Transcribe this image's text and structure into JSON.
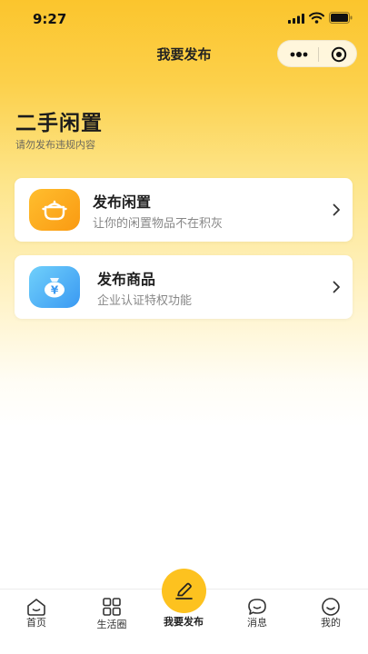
{
  "status_bar": {
    "time": "9:27"
  },
  "nav": {
    "title": "我要发布"
  },
  "header": {
    "title": "二手闲置",
    "subtitle": "请勿发布违规内容"
  },
  "cards": [
    {
      "title": "发布闲置",
      "description": "让你的闲置物品不在积灰",
      "icon": "pot-icon",
      "icon_color": "#fbab1d"
    },
    {
      "title": "发布商品",
      "description": "企业认证特权功能",
      "icon": "money-bag-icon",
      "icon_color": "#4aaef5"
    }
  ],
  "tab_bar": {
    "items": [
      {
        "label": "首页",
        "icon": "home-icon"
      },
      {
        "label": "生活圈",
        "icon": "grid-icon"
      },
      {
        "label": "我要发布",
        "icon": "pencil-icon",
        "active": true
      },
      {
        "label": "消息",
        "icon": "chat-icon"
      },
      {
        "label": "我的",
        "icon": "smile-icon"
      }
    ]
  },
  "colors": {
    "accent": "#fdc21f",
    "background_top": "#fbc52d"
  }
}
